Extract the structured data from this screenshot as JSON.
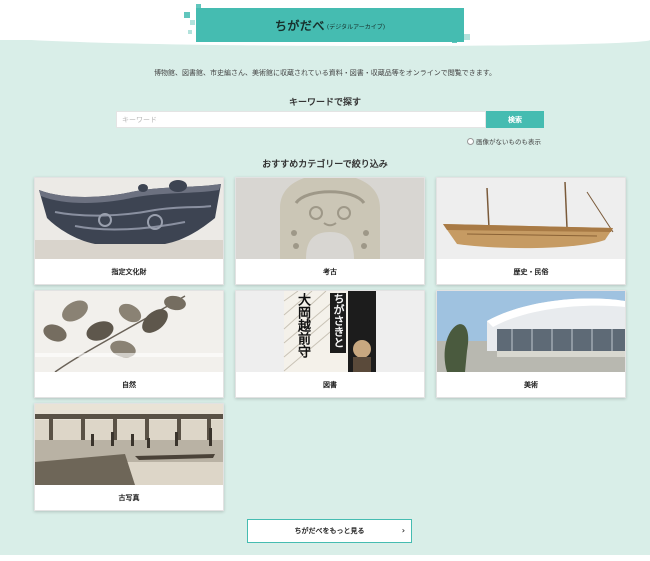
{
  "header": {
    "title": "ちがだべ",
    "subtitle": "(デジタルアーカイブ)"
  },
  "description": "博物館、図書館、市史編さん、美術館に収蔵されている資料・図書・収蔵品等をオンラインで閲覧できます。",
  "keyword_search": {
    "heading": "キーワードで探す",
    "placeholder": "キーワード",
    "value": "",
    "button_label": "検索",
    "checkbox_label": "画像がないものも表示"
  },
  "categories": {
    "heading": "おすすめカテゴリーで絞り込み",
    "items": [
      {
        "label": "指定文化財",
        "icon": "pottery-image"
      },
      {
        "label": "考古",
        "icon": "haniwa-image"
      },
      {
        "label": "歴史・民俗",
        "icon": "boat-model-image"
      },
      {
        "label": "自然",
        "icon": "plant-specimen-image"
      },
      {
        "label": "図書",
        "icon": "book-cover-image"
      },
      {
        "label": "美術",
        "icon": "museum-building-image"
      },
      {
        "label": "古写真",
        "icon": "old-photo-image"
      }
    ]
  },
  "book_cover_text": {
    "line1": "ちがさきと",
    "line2": "大岡越前守"
  },
  "more_button": {
    "label": "ちがだべをもっと見る",
    "arrow": "›"
  },
  "colors": {
    "accent": "#45bcb1",
    "background": "#d9eee8"
  }
}
